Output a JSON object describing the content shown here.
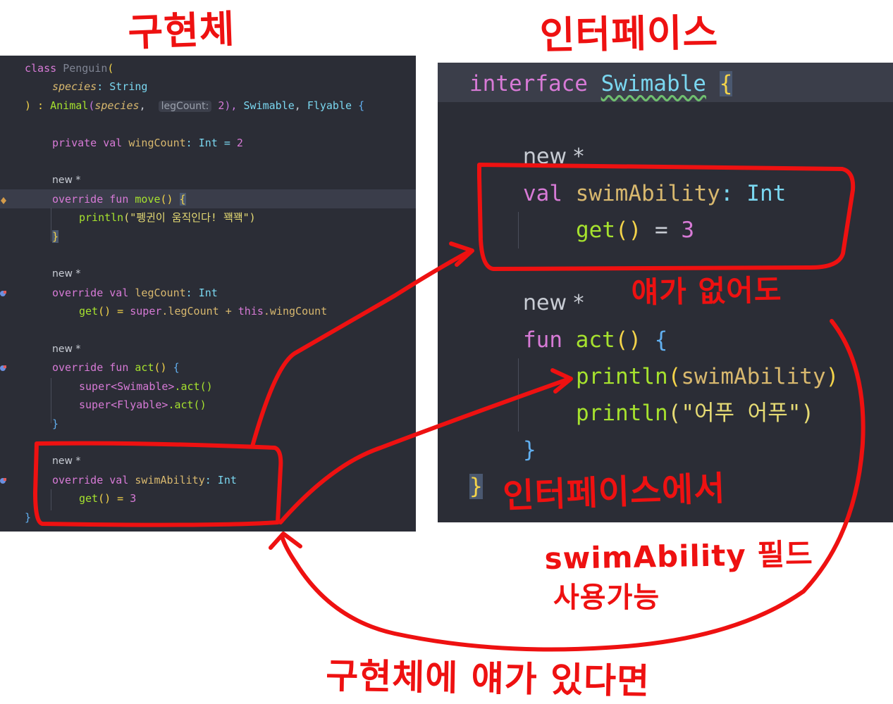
{
  "annotations": {
    "title_left": "구현체",
    "title_right": "인터페이스",
    "note_without": "얘가 없어도",
    "note_from_interface": "인터페이스에서",
    "note_field": "swimAbility 필드",
    "note_usable": "사용가능",
    "note_if_impl": "구현체에 얘가 있다면"
  },
  "left_code": {
    "kw_class": "class",
    "class_name": "Penguin",
    "paren_open": "(",
    "param_name": "species",
    "colon_type_string": ": String",
    "close_paren_colon": ") :",
    "animal": "Animal",
    "animal_args_open": "(",
    "animal_arg_species": "species",
    "comma1": ",",
    "inlay_legcount": "legCount:",
    "animal_arg_two": "2",
    "animal_args_close": "),",
    "swimable": "Swimable",
    "comma2": ",",
    "flyable": "Flyable",
    "brace_open": "{",
    "kw_private_val": "private val",
    "prop_wingcount": "wingCount",
    "wing_type": ": Int =",
    "wing_value": "2",
    "new1": "new *",
    "kw_override_fun": "override fun",
    "fn_move": "move",
    "move_parens": "()",
    "move_brace": "{",
    "println": "println",
    "println_str": "(\"펭귄이 움직인다! 꽥꽥\")",
    "close_brace": "}",
    "new2": "new *",
    "kw_override_val": "override val",
    "prop_legcount": "legCount",
    "int_type": ": Int",
    "get": "get",
    "get_eq": "() =",
    "super_kw": "super",
    "leg_expr": ".legCount +",
    "this_kw": "this",
    "wing_ref": ".wingCount",
    "new3": "new *",
    "fn_act": "act",
    "act_parens": "()",
    "act_brace": "{",
    "super_swimable": "super<Swimable>",
    "super_flyable": "super<Flyable>",
    "dot_act_call": ".act()",
    "new4": "new *",
    "prop_swimability": "swimAbility",
    "get_value": "3",
    "class_close": "}"
  },
  "right_code": {
    "kw_interface": "interface",
    "name": "Swimable",
    "brace_open": "{",
    "new1": "new *",
    "kw_val": "val",
    "prop": "swimAbility",
    "type": ": Int",
    "get": "get",
    "get_parens": "()",
    "eq": "=",
    "value": "3",
    "new2": "new *",
    "kw_fun": "fun",
    "fn_name": "act",
    "fn_parens": "()",
    "fn_brace": "{",
    "println": "println",
    "arg_paren_open": "(",
    "arg_swim": "swimAbility",
    "arg_paren_close": ")",
    "str_arg": "(\"어푸 어푸\")",
    "fn_close": "}",
    "close": "}"
  },
  "colors": {
    "editor_bg": "#2b2d36",
    "keyword": "#d77ad6",
    "function": "#a6e22e",
    "type": "#7ad7f0",
    "property": "#d8b86e",
    "string": "#e6db74",
    "annotation_red": "#ee1111"
  }
}
